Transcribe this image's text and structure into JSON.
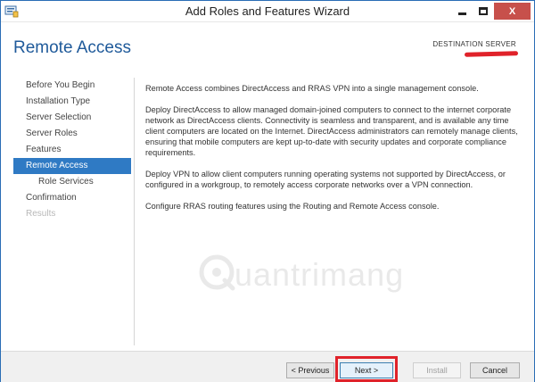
{
  "window": {
    "title": "Add Roles and Features Wizard",
    "minimize_label": "",
    "close_label": "X"
  },
  "header": {
    "page_title": "Remote Access",
    "destination_label": "DESTINATION SERVER"
  },
  "nav": {
    "items": [
      {
        "label": "Before You Begin",
        "state": "normal"
      },
      {
        "label": "Installation Type",
        "state": "normal"
      },
      {
        "label": "Server Selection",
        "state": "normal"
      },
      {
        "label": "Server Roles",
        "state": "normal"
      },
      {
        "label": "Features",
        "state": "normal"
      },
      {
        "label": "Remote Access",
        "state": "active"
      },
      {
        "label": "Role Services",
        "state": "sub"
      },
      {
        "label": "Confirmation",
        "state": "normal"
      },
      {
        "label": "Results",
        "state": "disabled"
      }
    ]
  },
  "content": {
    "paragraphs": [
      "Remote Access combines DirectAccess and RRAS VPN into a single management console.",
      "Deploy DirectAccess to allow managed domain-joined computers to connect to the internet corporate network as DirectAccess clients. Connectivity is seamless and transparent, and is available any time client computers are located on the Internet. DirectAccess administrators can remotely manage clients, ensuring that mobile computers are kept up-to-date with security updates and corporate compliance requirements.",
      "Deploy VPN to allow client computers running operating systems not supported by DirectAccess, or configured in a workgroup, to remotely access corporate networks over a VPN connection.",
      "Configure RRAS routing features using the Routing and Remote Access console."
    ]
  },
  "watermark": {
    "text": "uantrimang"
  },
  "footer": {
    "previous_label": "< Previous",
    "next_label": "Next >",
    "install_label": "Install",
    "cancel_label": "Cancel"
  },
  "colors": {
    "accent": "#2f7ac4",
    "title_blue": "#1f5a9a",
    "close_red": "#c7504b",
    "annotation_red": "#e0222a"
  }
}
